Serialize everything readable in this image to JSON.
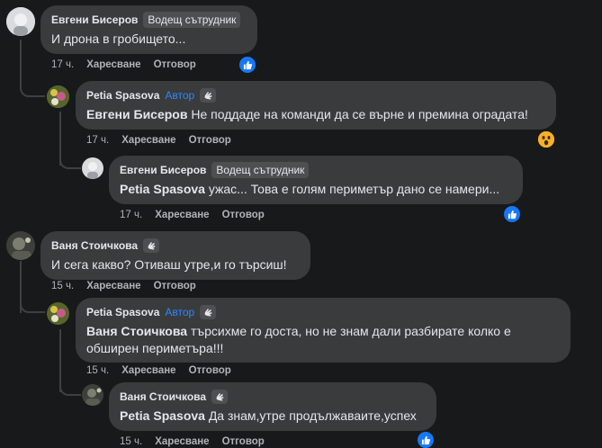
{
  "comments": [
    {
      "author": "Евгени Бисеров",
      "badge": "Водещ сътрудник",
      "text": "И дрона в гробището...",
      "time": "17 ч.",
      "like": "Харесване",
      "reply": "Отговор",
      "reaction": "like"
    },
    {
      "author": "Petia Spasova",
      "badge": "Автор",
      "mention": "Евгени Бисеров",
      "text": "Не поддаде на команди да се върне и премина оградата!",
      "time": "17 ч.",
      "like": "Харесване",
      "reply": "Отговор",
      "reaction": "wow"
    },
    {
      "author": "Евгени Бисеров",
      "badge": "Водещ сътрудник",
      "mention": "Petia Spasova",
      "text": "ужас... Това е голям периметър дано се намери...",
      "time": "17 ч.",
      "like": "Харесване",
      "reply": "Отговор",
      "reaction": "like"
    },
    {
      "author": "Ваня Стоичкова",
      "text": "И сега какво? Отиваш утре,и го търсиш!",
      "time": "15 ч.",
      "like": "Харесване",
      "reply": "Отговор"
    },
    {
      "author": "Petia Spasova",
      "badge": "Автор",
      "mention": "Ваня Стоичкова",
      "text_line1": "търсихме го доста, но не знам дали разбирате колко е",
      "text_line2": "обширен периметъра!!!",
      "time": "15 ч.",
      "like": "Харесване",
      "reply": "Отговор"
    },
    {
      "author": "Ваня Стоичкова",
      "mention": "Petia Spasova",
      "text": "Да знам,утре продължаваите,успех",
      "time": "15 ч.",
      "like": "Харесване",
      "reply": "Отговор",
      "reaction": "like"
    }
  ],
  "colors": {
    "background": "#18191a",
    "bubble": "#3a3b3c",
    "author_badge": "#2d88ff",
    "like": "#1877f2",
    "wow": "#f7b125"
  }
}
